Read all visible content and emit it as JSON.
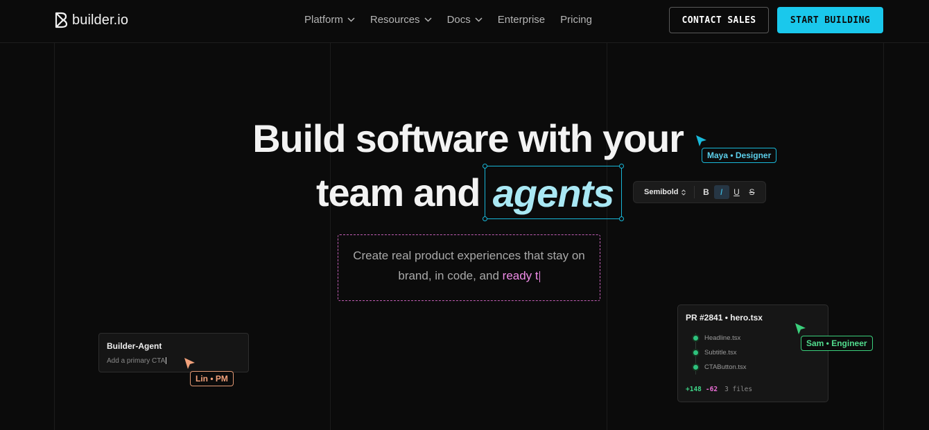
{
  "nav": {
    "logo_text": "builder.io",
    "menu": [
      {
        "label": "Platform",
        "has_dropdown": true
      },
      {
        "label": "Resources",
        "has_dropdown": true
      },
      {
        "label": "Docs",
        "has_dropdown": true
      },
      {
        "label": "Enterprise",
        "has_dropdown": false
      },
      {
        "label": "Pricing",
        "has_dropdown": false
      }
    ],
    "contact_label": "CONTACT SALES",
    "start_label": "START BUILDING"
  },
  "hero": {
    "line1": "Build software with your",
    "line2_prefix": "team and",
    "line2_highlight": "agents",
    "subtitle_main": "Create real product experiences that stay on brand, in code, and",
    "subtitle_typed": "ready t"
  },
  "toolbar": {
    "weight": "Semibold",
    "buttons": [
      "B",
      "I",
      "U",
      "S"
    ],
    "active": "I"
  },
  "collaborators": {
    "maya": "Maya • Designer",
    "lin": "Lin • PM",
    "sam": "Sam • Engineer"
  },
  "agent_card": {
    "title": "Builder-Agent",
    "input_value": "Add a primary CTA"
  },
  "pr_card": {
    "title": "PR #2841 • hero.tsx",
    "files": [
      "Headline.tsx",
      "Subtitle.tsx",
      "CTAButton.tsx"
    ],
    "additions": "+148",
    "deletions": "-62",
    "files_count": "3 files"
  },
  "colors": {
    "background": "#0b0b0b",
    "accent_cyan": "#1ac8ec",
    "pink": "#f08ce8",
    "green": "#3ed386",
    "orange": "#f2a17b"
  }
}
